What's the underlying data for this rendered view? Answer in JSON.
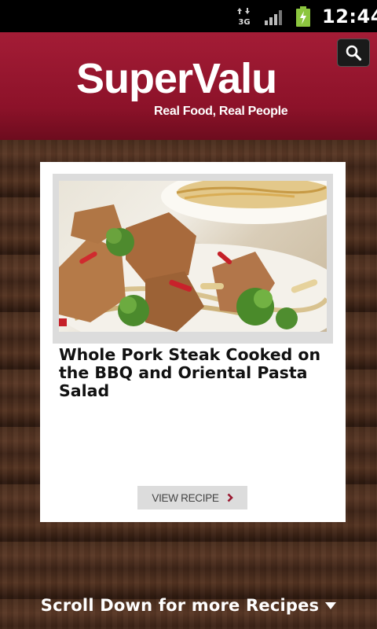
{
  "status_bar": {
    "network": "3G",
    "time": "12:44"
  },
  "header": {
    "brand": "SuperValu",
    "tagline": "Real Food, Real People",
    "brand_color": "#9a1830"
  },
  "recipe_card": {
    "title": "Whole Pork Steak Cooked on the BBQ and Oriental Pasta Salad",
    "button_label": "VIEW RECIPE",
    "chevron_color": "#9a1830"
  },
  "footer": {
    "scroll_label": "Scroll Down for more Recipes"
  },
  "icons": {
    "search": "search-icon",
    "chevron": "chevron-right-icon",
    "caret": "caret-down-icon"
  }
}
